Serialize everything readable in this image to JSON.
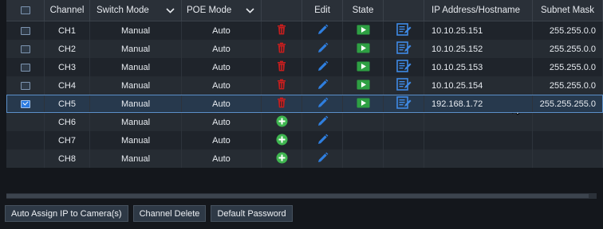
{
  "header": {
    "select_all_checked": false,
    "channel": "Channel",
    "switch_mode": "Switch Mode",
    "poe_mode": "POE Mode",
    "delete": "",
    "edit": "Edit",
    "state": "State",
    "config": "",
    "ip": "IP Address/Hostname",
    "mask": "Subnet Mask"
  },
  "rows": [
    {
      "channel": "CH1",
      "switch_mode": "Manual",
      "poe_mode": "Auto",
      "action": "delete",
      "has_state": true,
      "ip": "10.10.25.151",
      "mask": "255.255.0.0",
      "checked": false
    },
    {
      "channel": "CH2",
      "switch_mode": "Manual",
      "poe_mode": "Auto",
      "action": "delete",
      "has_state": true,
      "ip": "10.10.25.152",
      "mask": "255.255.0.0",
      "checked": false
    },
    {
      "channel": "CH3",
      "switch_mode": "Manual",
      "poe_mode": "Auto",
      "action": "delete",
      "has_state": true,
      "ip": "10.10.25.153",
      "mask": "255.255.0.0",
      "checked": false
    },
    {
      "channel": "CH4",
      "switch_mode": "Manual",
      "poe_mode": "Auto",
      "action": "delete",
      "has_state": true,
      "ip": "10.10.25.154",
      "mask": "255.255.0.0",
      "checked": false
    },
    {
      "channel": "CH5",
      "switch_mode": "Manual",
      "poe_mode": "Auto",
      "action": "delete",
      "has_state": true,
      "ip": "192.168.1.72",
      "mask": "255.255.255.0",
      "checked": true
    },
    {
      "channel": "CH6",
      "switch_mode": "Manual",
      "poe_mode": "Auto",
      "action": "add",
      "has_state": false,
      "ip": "",
      "mask": "",
      "checked": null
    },
    {
      "channel": "CH7",
      "switch_mode": "Manual",
      "poe_mode": "Auto",
      "action": "add",
      "has_state": false,
      "ip": "",
      "mask": "",
      "checked": null
    },
    {
      "channel": "CH8",
      "switch_mode": "Manual",
      "poe_mode": "Auto",
      "action": "add",
      "has_state": false,
      "ip": "",
      "mask": "",
      "checked": null
    }
  ],
  "buttons": {
    "auto_assign": "Auto Assign IP to Camera(s)",
    "channel_delete": "Channel Delete",
    "default_password": "Default Password"
  },
  "colors": {
    "delete_icon": "#c81e1e",
    "edit_icon": "#2f7fe0",
    "state_icon": "#2ea043",
    "add_icon": "#3fb650",
    "config_icon": "#3f8ae6",
    "selection_outline": "#5b8fc9"
  },
  "icons": {
    "delete": "trash-icon",
    "add": "plus-circle-icon",
    "edit": "pencil-icon",
    "state": "play-icon",
    "config": "config-list-icon"
  }
}
